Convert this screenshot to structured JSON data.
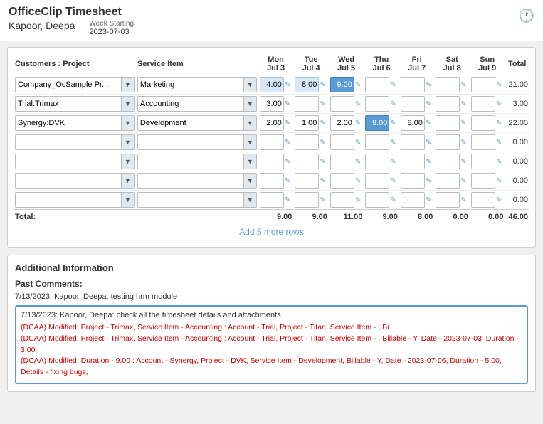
{
  "app": {
    "title": "OfficeClip Timesheet",
    "user": "Kapoor, Deepa",
    "week_label": "Week Starting",
    "week_date": "2023-07-03",
    "history_icon": "🕐"
  },
  "table": {
    "headers": {
      "customer_project": "Customers : Project",
      "service_item": "Service Item",
      "mon": "Mon",
      "mon_date": "Jul 3",
      "tue": "Tue",
      "tue_date": "Jul 4",
      "wed": "Wed",
      "wed_date": "Jul 5",
      "thu": "Thu",
      "thu_date": "Jul 6",
      "fri": "Fri",
      "fri_date": "Jul 7",
      "sat": "Sat",
      "sat_date": "Jul 8",
      "sun": "Sun",
      "sun_date": "Jul 9",
      "total": "Total"
    },
    "rows": [
      {
        "customer": "Company_OcSample Pr...",
        "service": "Marketing",
        "mon": "4.00",
        "tue": "8.00",
        "wed": "9.00",
        "thu": "",
        "fri": "",
        "sat": "",
        "sun": "",
        "wed_highlighted": true,
        "total": "21.00"
      },
      {
        "customer": "Trial:Trimax",
        "service": "Accounting",
        "mon": "3.00",
        "tue": "",
        "wed": "",
        "thu": "",
        "fri": "",
        "sat": "",
        "sun": "",
        "total": "3.00"
      },
      {
        "customer": "Synergy:DVK",
        "service": "Development",
        "mon": "2.00",
        "tue": "1.00",
        "wed": "2.00",
        "thu": "9.00",
        "fri": "8.00",
        "sat": "",
        "sun": "",
        "thu_highlighted": true,
        "total": "22.00"
      },
      {
        "customer": "",
        "service": "",
        "mon": "",
        "tue": "",
        "wed": "",
        "thu": "",
        "fri": "",
        "sat": "",
        "sun": "",
        "total": "0.00"
      },
      {
        "customer": "",
        "service": "",
        "mon": "",
        "tue": "",
        "wed": "",
        "thu": "",
        "fri": "",
        "sat": "",
        "sun": "",
        "total": "0.00"
      },
      {
        "customer": "",
        "service": "",
        "mon": "",
        "tue": "",
        "wed": "",
        "thu": "",
        "fri": "",
        "sat": "",
        "sun": "",
        "total": "0.00"
      },
      {
        "customer": "",
        "service": "",
        "mon": "",
        "tue": "",
        "wed": "",
        "thu": "",
        "fri": "",
        "sat": "",
        "sun": "",
        "total": "0.00"
      }
    ],
    "totals": {
      "label": "Total:",
      "mon": "9.00",
      "tue": "9.00",
      "wed": "11.00",
      "thu": "9.00",
      "fri": "8.00",
      "sat": "0.00",
      "sun": "0.00",
      "grand": "46.00"
    },
    "add_rows_link": "Add 5 more rows"
  },
  "additional": {
    "section_title": "Additional Information",
    "past_comments_label": "Past Comments:",
    "comment1_date": "7/13/2023:",
    "comment1_text": "Kapoor, Deepa: testing hrm module",
    "highlighted_box": {
      "header_date": "7/13/2023:",
      "header_text": "Kapoor, Deepa: check all the timesheet details and attachments",
      "lines": [
        "(DCAA) Modified: Project - Trimax, Service Item - Accounting : Account - Trial, Project - Titan, Service Item - , Bi",
        "(DCAA) Modified: Project - Trimax, Service Item - Accounting : Account - Trial, Project - Titan, Service Item - , Billable - Y, Date - 2023-07-03, Duration - 3.00,",
        "(DCAA) Modified: Duration - 9.00 : Account - Synergy, Project - DVK, Service Item - Development, Billable - Y, Date - 2023-07-06, Duration - 5.00, Details - fixing bugs,"
      ]
    }
  }
}
